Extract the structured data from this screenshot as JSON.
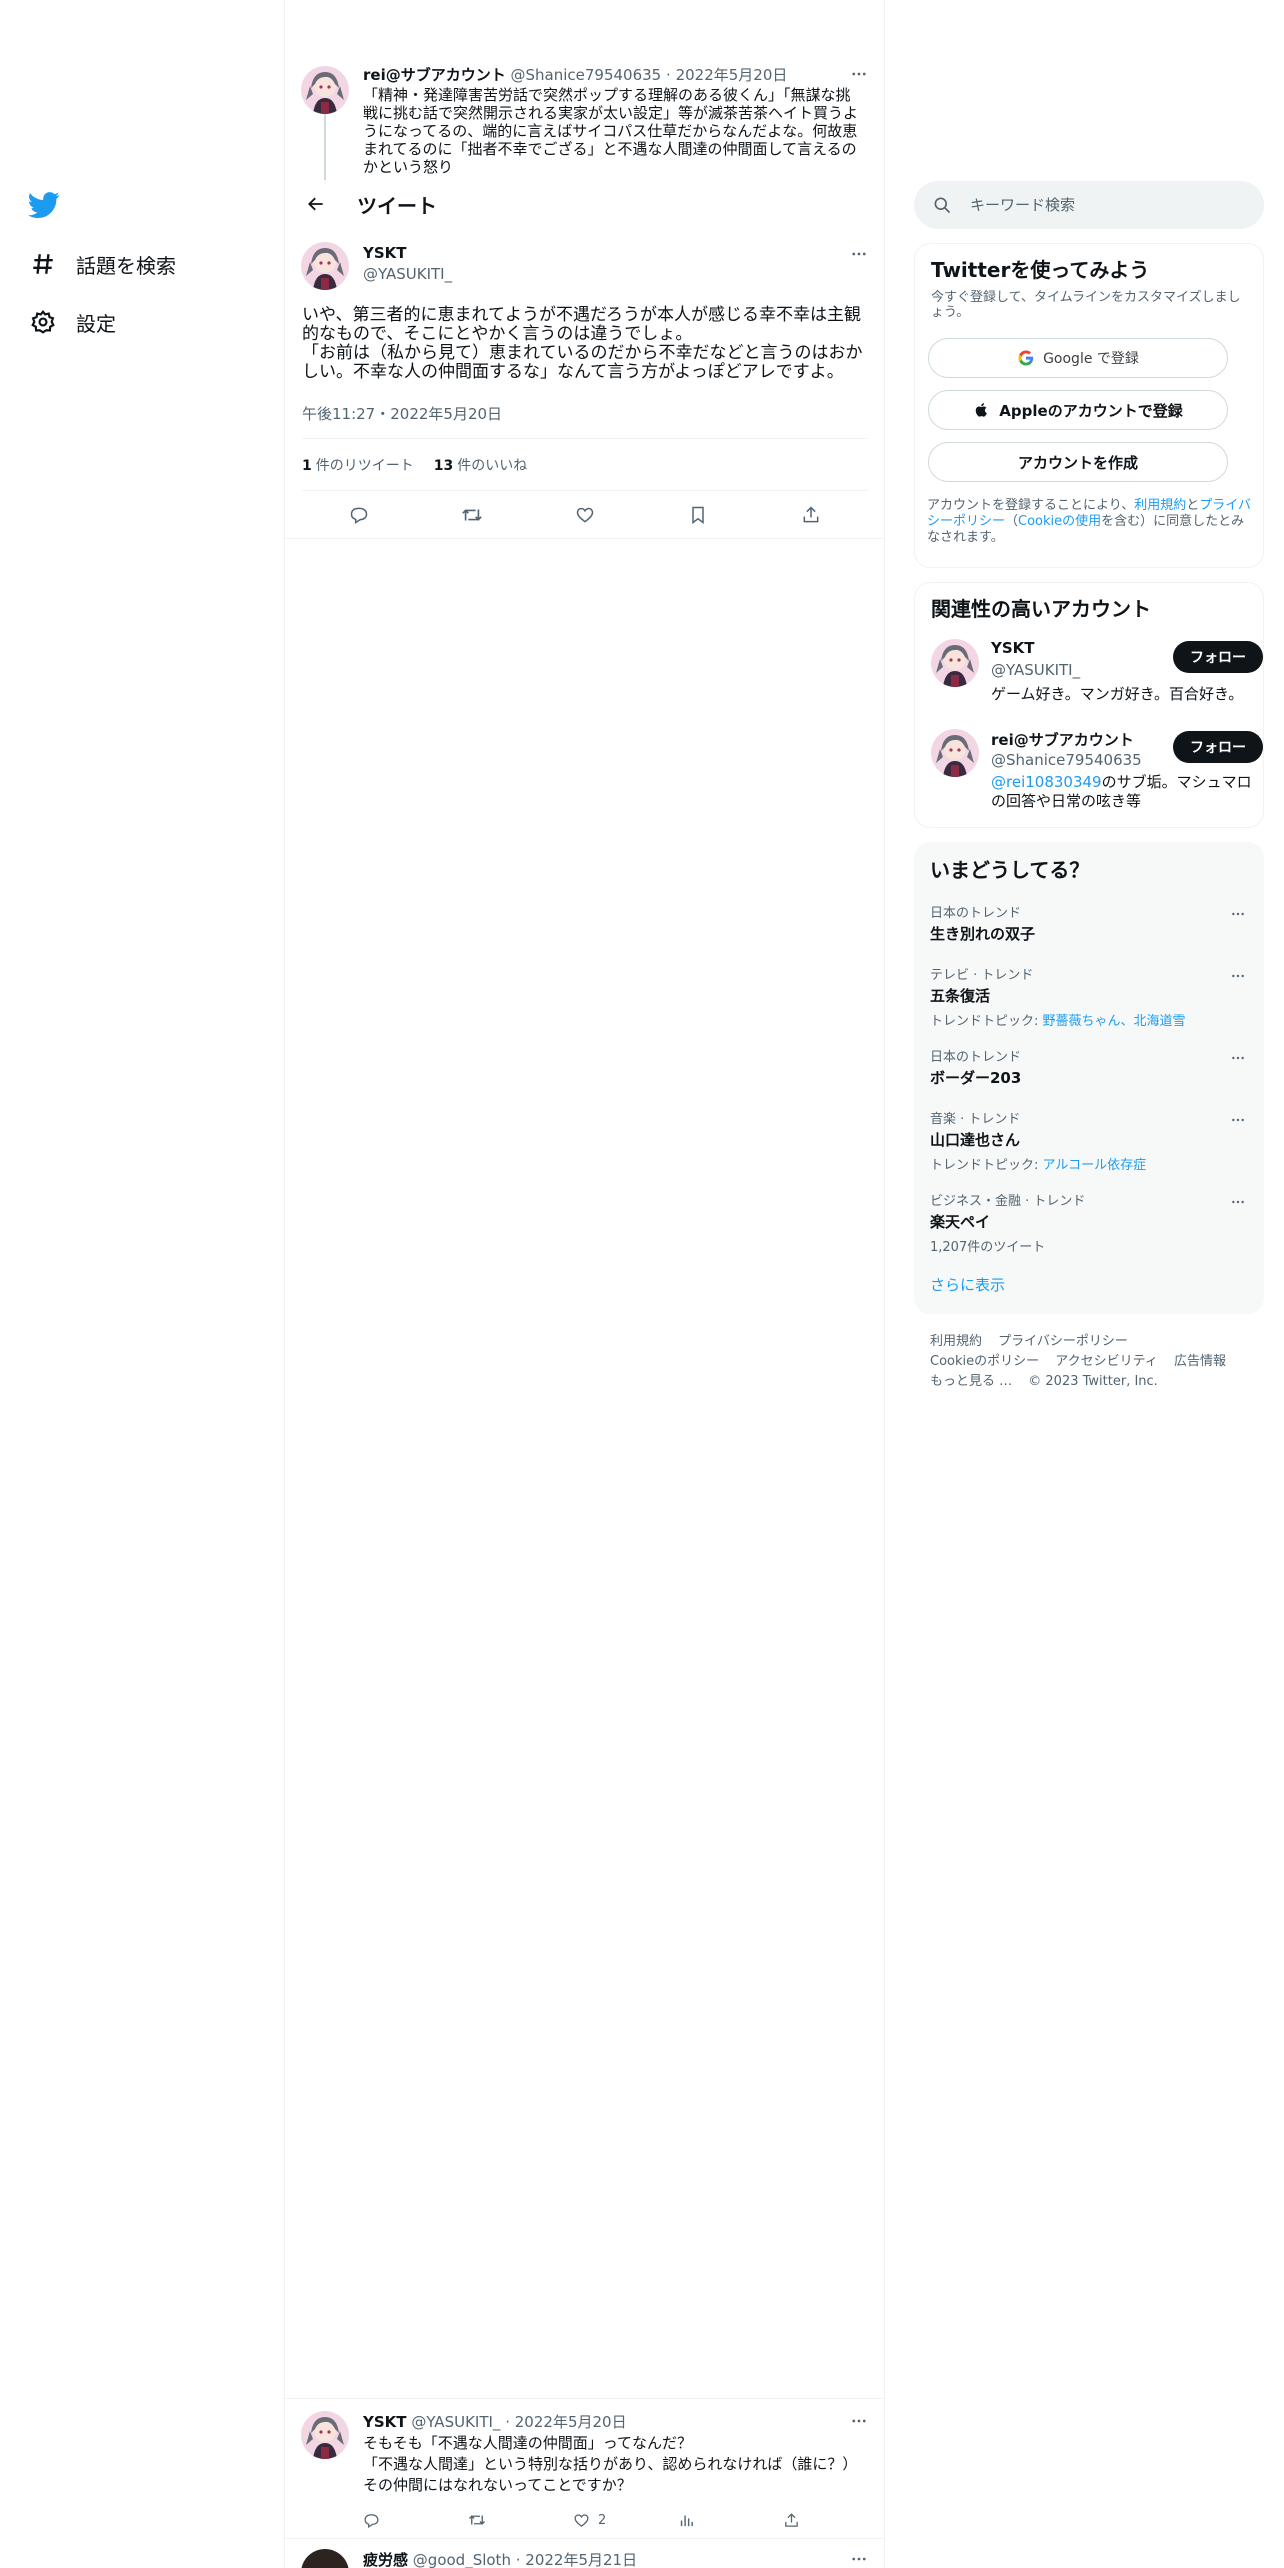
{
  "nav": {
    "explore_label": "話題を検索",
    "settings_label": "設定"
  },
  "main": {
    "header_title": "ツイート",
    "parent_tweet": {
      "name": "rei@サブアカウント",
      "handle": "@Shanice79540635",
      "date": "2022年5月20日",
      "text": "「精神・発達障害苦労話で突然ポップする理解のある彼くん」「無謀な挑戦に挑む話で突然開示される実家が太い設定」等が滅茶苦茶ヘイト買うようになってるの、端的に言えばサイコパス仕草だからなんだよな。何故恵まれてるのに「拙者不幸でござる」と不遇な人間達の仲間面して言えるのかという怒り"
    },
    "focus_tweet": {
      "name": "YSKT",
      "handle": "@YASUKITI_",
      "text_line1": "いや、第三者的に恵まれてようが不遇だろうが本人が感じる幸不幸は主観的なもので、そこにとやかく言うのは違うでしょ。",
      "text_line2": "「お前は（私から見て）恵まれているのだから不幸だなどと言うのはおかしい。不幸な人の仲間面するな」なんて言う方がよっぽどアレですよ。",
      "time": "午後11:27・2022年5月20日",
      "retweets_count": "1",
      "retweets_label": "件のリツイート",
      "likes_count": "13",
      "likes_label": "件のいいね"
    },
    "reply_tweet": {
      "name": "YSKT",
      "handle": "@YASUKITI_",
      "date": "2022年5月20日",
      "text_line1": "そもそも「不遇な人間達の仲間面」ってなんだ？",
      "text_line2": "「不遇な人間達」という特別な括りがあり、認められなければ（誰に？）その仲間にはなれないってことですか？",
      "like_count": "2"
    },
    "next_tweet": {
      "name": "疲労感",
      "handle": "@good_Sloth",
      "date": "2022年5月21日"
    }
  },
  "sidebar": {
    "search_placeholder": "キーワード検索",
    "signup": {
      "title": "Twitterを使ってみよう",
      "desc": "今すぐ登録して、タイムラインをカスタマイズしましょう。",
      "google_label": "Google で登録",
      "apple_label": "Appleのアカウントで登録",
      "create_label": "アカウントを作成",
      "legal_prefix": "アカウントを登録することにより、",
      "terms_link": "利用規約",
      "and": "と",
      "privacy_link": "プライバシーポリシー",
      "paren_open": "（",
      "cookie_link": "Cookieの使用",
      "legal_suffix": "を含む）に同意したとみなされます。"
    },
    "who_to_follow": {
      "title": "関連性の高いアカウント",
      "follow_label": "フォロー",
      "accounts": [
        {
          "name": "YSKT",
          "handle": "@YASUKITI_",
          "bio": "ゲーム好き。マンガ好き。百合好き。"
        },
        {
          "name": "rei@サブアカウント",
          "handle": "@Shanice79540635",
          "bio_link": "@rei10830349",
          "bio": "のサブ垢。マシュマロの回答や日常の呟き等"
        }
      ]
    },
    "trends": {
      "title": "いまどうしてる？",
      "items": [
        {
          "category": "日本のトレンド",
          "name": "生き別れの双子"
        },
        {
          "category": "テレビ · トレンド",
          "name": "五条復活",
          "sub_prefix": "トレンドトピック: ",
          "sub_links": "野薔薇ちゃん、北海道雪"
        },
        {
          "category": "日本のトレンド",
          "name": "ボーダー203"
        },
        {
          "category": "音楽 · トレンド",
          "name": "山口達也さん",
          "sub_prefix": "トレンドトピック: ",
          "sub_links": "アルコール依存症"
        },
        {
          "category": "ビジネス・金融 · トレンド",
          "name": "楽天ペイ",
          "sub_plain": "1,207件のツイート"
        }
      ],
      "show_more": "さらに表示"
    },
    "footer": {
      "terms": "利用規約",
      "privacy": "プライバシーポリシー",
      "cookie": "Cookieのポリシー",
      "accessibility": "アクセシビリティ",
      "ads": "広告情報",
      "more": "もっと見る …",
      "copyright": "© 2023 Twitter, Inc."
    }
  },
  "colors": {
    "accent": "#1d9bf0",
    "text": "#0f1419",
    "muted": "#536471",
    "border": "#eff3f4"
  },
  "icons": [
    "twitter-logo-icon",
    "hashtag-icon",
    "gear-icon",
    "back-arrow-icon",
    "more-icon",
    "reply-icon",
    "retweet-icon",
    "like-icon",
    "bookmark-icon",
    "share-icon",
    "analytics-icon",
    "search-icon",
    "google-icon",
    "apple-icon"
  ]
}
